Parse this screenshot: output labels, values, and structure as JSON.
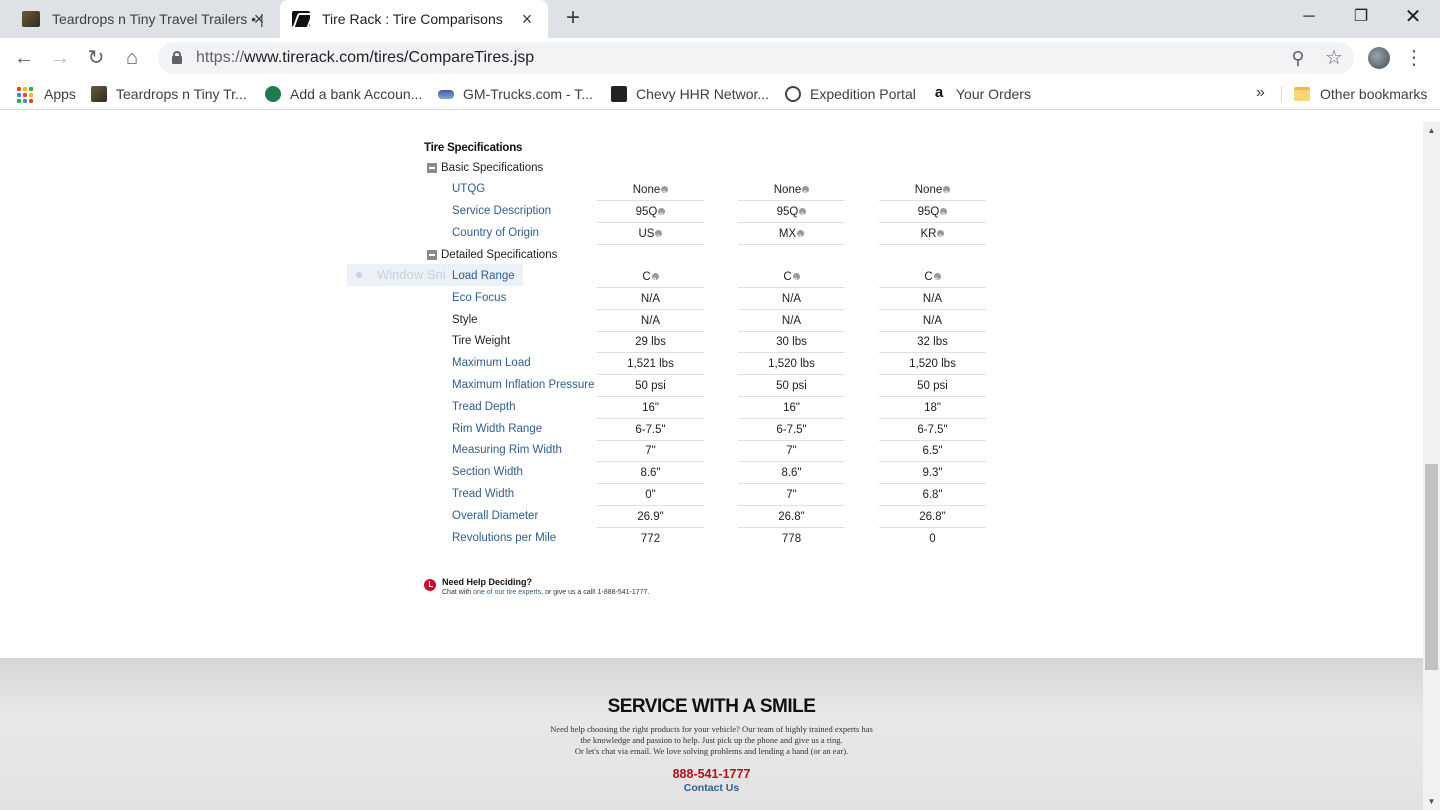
{
  "browser": {
    "tabs": [
      {
        "title": "Teardrops n Tiny Travel Trailers • |",
        "active": false
      },
      {
        "title": "Tire Rack : Tire Comparisons",
        "active": true
      }
    ],
    "url": {
      "scheme": "https://",
      "rest": "www.tirerack.com/tires/CompareTires.jsp"
    },
    "bookmarks": [
      {
        "label": "Apps",
        "icon": "apps-grid-icon"
      },
      {
        "label": "Teardrops n Tiny Tr...",
        "icon": "teardrops-favicon"
      },
      {
        "label": "Add a bank Accoun...",
        "icon": "bank-favicon"
      },
      {
        "label": "GM-Trucks.com - T...",
        "icon": "gm-trucks-favicon"
      },
      {
        "label": "Chevy HHR Networ...",
        "icon": "hhr-favicon"
      },
      {
        "label": "Expedition Portal",
        "icon": "expedition-favicon"
      },
      {
        "label": "Your Orders",
        "icon": "amazon-favicon"
      }
    ],
    "overflow_label": "»",
    "other_bookmarks": "Other bookmarks"
  },
  "page": {
    "section_title": "Tire Specifications",
    "ghost_overlay": "Window Sni",
    "basic_header": "Basic Specifications",
    "detailed_header": "Detailed Specifications",
    "basic_rows": [
      {
        "label": "UTQG",
        "values": [
          "None",
          "None",
          "None"
        ],
        "info": true,
        "link": true
      },
      {
        "label": "Service Description",
        "values": [
          "95Q",
          "95Q",
          "95Q"
        ],
        "info": true,
        "link": true
      },
      {
        "label": "Country of Origin",
        "values": [
          "US",
          "MX",
          "KR"
        ],
        "info": true,
        "link": true
      }
    ],
    "detailed_rows": [
      {
        "label": "Load Range",
        "values": [
          "C",
          "C",
          "C"
        ],
        "info": true,
        "link": true
      },
      {
        "label": "Eco Focus",
        "values": [
          "N/A",
          "N/A",
          "N/A"
        ],
        "info": false,
        "link": true
      },
      {
        "label": "Style",
        "values": [
          "N/A",
          "N/A",
          "N/A"
        ],
        "info": false,
        "link": false
      },
      {
        "label": "Tire Weight",
        "values": [
          "29 lbs",
          "30 lbs",
          "32 lbs"
        ],
        "info": false,
        "link": false
      },
      {
        "label": "Maximum Load",
        "values": [
          "1,521 lbs",
          "1,520 lbs",
          "1,520 lbs"
        ],
        "info": false,
        "link": true
      },
      {
        "label": "Maximum Inflation Pressure",
        "values": [
          "50 psi",
          "50 psi",
          "50 psi"
        ],
        "info": false,
        "link": true
      },
      {
        "label": "Tread Depth",
        "values": [
          "16\"",
          "16\"",
          "18\""
        ],
        "info": false,
        "link": true
      },
      {
        "label": "Rim Width Range",
        "values": [
          "6-7.5\"",
          "6-7.5\"",
          "6-7.5\""
        ],
        "info": false,
        "link": true
      },
      {
        "label": "Measuring Rim Width",
        "values": [
          "7\"",
          "7\"",
          "6.5\""
        ],
        "info": false,
        "link": true
      },
      {
        "label": "Section Width",
        "values": [
          "8.6\"",
          "8.6\"",
          "9.3\""
        ],
        "info": false,
        "link": true
      },
      {
        "label": "Tread Width",
        "values": [
          "0\"",
          "7\"",
          "6.8\""
        ],
        "info": false,
        "link": true
      },
      {
        "label": "Overall Diameter",
        "values": [
          "26.9\"",
          "26.8\"",
          "26.8\""
        ],
        "info": false,
        "link": true
      },
      {
        "label": "Revolutions per Mile",
        "values": [
          "772",
          "778",
          "0"
        ],
        "info": false,
        "link": true
      }
    ],
    "help": {
      "title": "Need Help Deciding?",
      "text_before": "Chat with ",
      "link": "one of our tire experts",
      "text_after": ", or give us a call! 1-888-541-1777."
    }
  },
  "footer": {
    "title": "SERVICE WITH A SMILE",
    "lines": [
      "Need help choosing the right products for your vehicle? Our team of highly trained experts has",
      "the knowledge and passion to help. Just pick up the phone and give us a ring.",
      "Or let's chat via email. We love solving problems and lending a hand (or an ear)."
    ],
    "phone": "888-541-1777",
    "contact": "Contact Us"
  },
  "colors": {
    "link": "#2f5f8e",
    "phone": "#b5121b",
    "help_icon": "#c8102e"
  }
}
